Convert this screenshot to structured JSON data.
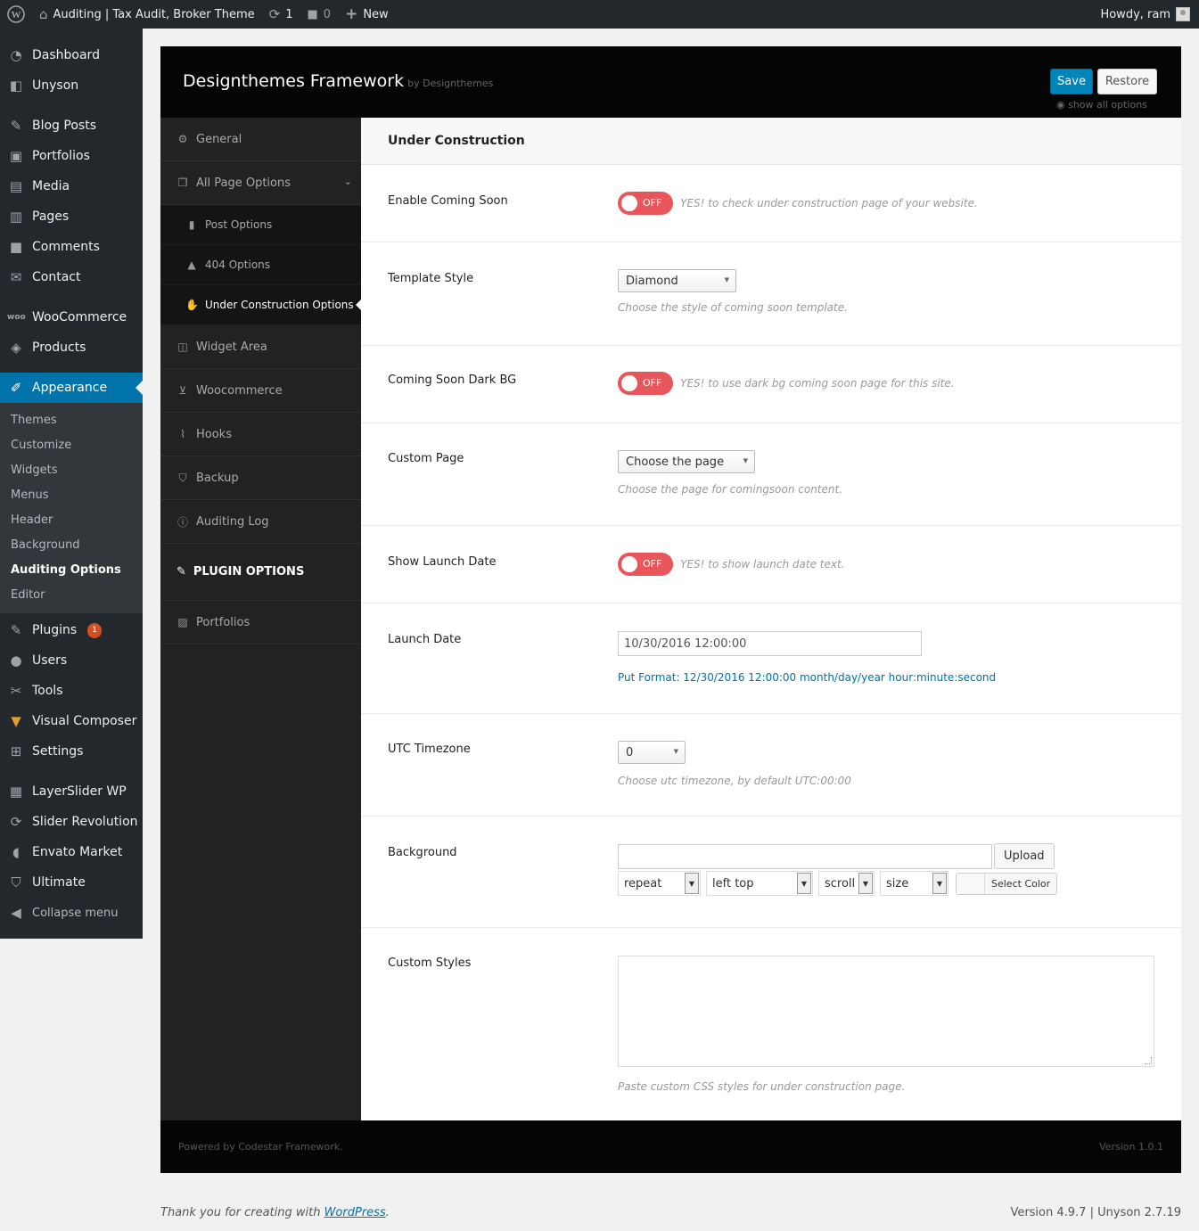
{
  "adminbar": {
    "site_title": "Auditing | Tax Audit, Broker Theme",
    "updates_count": "1",
    "comments_count": "0",
    "new_label": "New",
    "howdy": "Howdy, ram"
  },
  "sidebar": {
    "group1": [
      {
        "label": "Dashboard",
        "icon": "dashboard-icon"
      },
      {
        "label": "Unyson",
        "icon": "unyson-icon"
      }
    ],
    "group2": [
      {
        "label": "Blog Posts",
        "icon": "pin-icon"
      },
      {
        "label": "Portfolios",
        "icon": "portfolio-icon"
      },
      {
        "label": "Media",
        "icon": "media-icon"
      },
      {
        "label": "Pages",
        "icon": "pages-icon"
      },
      {
        "label": "Comments",
        "icon": "comments-icon"
      },
      {
        "label": "Contact",
        "icon": "mail-icon"
      }
    ],
    "group3": [
      {
        "label": "WooCommerce",
        "icon": "woo-icon"
      },
      {
        "label": "Products",
        "icon": "box-icon"
      }
    ],
    "appearance": {
      "label": "Appearance",
      "icon": "paintbrush-icon"
    },
    "appearance_sub": [
      "Themes",
      "Customize",
      "Widgets",
      "Menus",
      "Header",
      "Background",
      "Auditing Options",
      "Editor"
    ],
    "group4": [
      {
        "label": "Plugins",
        "icon": "plug-icon",
        "badge": "1"
      },
      {
        "label": "Users",
        "icon": "user-icon"
      },
      {
        "label": "Tools",
        "icon": "wrench-icon"
      },
      {
        "label": "Visual Composer",
        "icon": "vc-icon"
      },
      {
        "label": "Settings",
        "icon": "settings-icon"
      }
    ],
    "group5": [
      {
        "label": "LayerSlider WP",
        "icon": "layers-icon"
      },
      {
        "label": "Slider Revolution",
        "icon": "refresh-icon"
      },
      {
        "label": "Envato Market",
        "icon": "leaf-icon"
      },
      {
        "label": "Ultimate",
        "icon": "shield-icon"
      },
      {
        "label": "Collapse menu",
        "icon": "collapse-icon"
      }
    ]
  },
  "panel": {
    "title": "Designthemes Framework",
    "by": "by Designthemes",
    "save_label": "Save",
    "restore_label": "Restore",
    "show_all": "show all options",
    "nav": {
      "general": "General",
      "all_page_options": "All Page Options",
      "post_options": "Post Options",
      "options_404": "404 Options",
      "under_construction": "Under Construction Options",
      "widget_area": "Widget Area",
      "woocommerce": "Woocommerce",
      "hooks": "Hooks",
      "backup": "Backup",
      "auditing_log": "Auditing Log",
      "plugin_options": "PLUGIN OPTIONS",
      "portfolios": "Portfolios"
    },
    "section_title": "Under Construction",
    "fields": {
      "enable_coming_soon": {
        "label": "Enable Coming Soon",
        "toggle": "OFF",
        "help": "YES! to check under construction page of your website."
      },
      "template_style": {
        "label": "Template Style",
        "value": "Diamond",
        "help": "Choose the style of coming soon template."
      },
      "dark_bg": {
        "label": "Coming Soon Dark BG",
        "toggle": "OFF",
        "help": "YES! to use dark bg coming soon page for this site."
      },
      "custom_page": {
        "label": "Custom Page",
        "value": "Choose the page",
        "help": "Choose the page for comingsoon content."
      },
      "show_launch_date": {
        "label": "Show Launch Date",
        "toggle": "OFF",
        "help": "YES! to show launch date text."
      },
      "launch_date": {
        "label": "Launch Date",
        "value": "10/30/2016 12:00:00",
        "help": "Put Format: 12/30/2016 12:00:00 month/day/year hour:minute:second"
      },
      "utc_timezone": {
        "label": "UTC Timezone",
        "value": "0",
        "help": "Choose utc timezone, by default UTC:00:00"
      },
      "background": {
        "label": "Background",
        "upload_label": "Upload",
        "repeat": "repeat",
        "position": "left top",
        "attachment": "scroll",
        "size": "size",
        "color_label": "Select Color"
      },
      "custom_styles": {
        "label": "Custom Styles",
        "help": "Paste custom CSS styles for under construction page."
      }
    },
    "footer_left": "Powered by Codestar Framework.",
    "footer_right": "Version 1.0.1"
  },
  "wpfooter": {
    "thanks_prefix": "Thank you for creating with ",
    "wordpress_link": "WordPress",
    "thanks_suffix": ".",
    "version": "Version 4.9.7 | Unyson 2.7.19"
  },
  "colors": {
    "admin_dark": "#23282d",
    "accent": "#0073aa",
    "toggle_off": "#e8555a"
  }
}
